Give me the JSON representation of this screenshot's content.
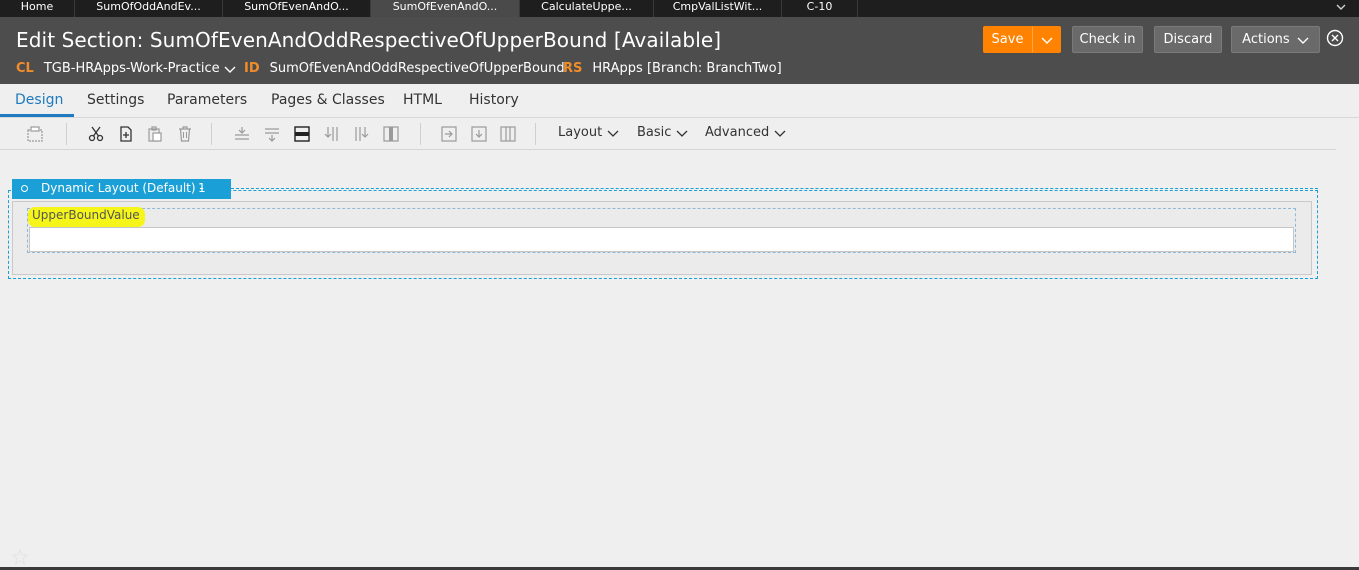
{
  "tabs": [
    {
      "label": "Home",
      "active": false
    },
    {
      "label": "SumOfOddAndEv...",
      "active": false
    },
    {
      "label": "SumOfEvenAndO...",
      "active": false
    },
    {
      "label": "SumOfEvenAndO...",
      "active": true
    },
    {
      "label": "CalculateUppe...",
      "active": false
    },
    {
      "label": "CmpValListWit...",
      "active": false
    },
    {
      "label": "C-10",
      "active": false
    }
  ],
  "header": {
    "title": "Edit Section: SumOfEvenAndOddRespectiveOfUpperBound [Available]",
    "cl_key": "CL",
    "cl_value": "TGB-HRApps-Work-Practice",
    "id_key": "ID",
    "id_value": "SumOfEvenAndOddRespectiveOfUpperBound",
    "rs_key": "RS",
    "rs_value": "HRApps [Branch: BranchTwo]"
  },
  "actions": {
    "save": "Save",
    "check_in": "Check in",
    "discard": "Discard",
    "actions": "Actions"
  },
  "subtabs": [
    "Design",
    "Settings",
    "Parameters",
    "Pages & Classes",
    "HTML",
    "History"
  ],
  "toolbar": {
    "menus": [
      "Layout",
      "Basic",
      "Advanced"
    ]
  },
  "canvas": {
    "layout_label": "Dynamic Layout (Default) -",
    "layout_number": "1",
    "field_label": "UpperBoundValue",
    "field_value": ""
  },
  "colors": {
    "accent": "#ff8300",
    "layout_blue": "#1a9fd6",
    "highlight": "#f5f51a",
    "active_tab": "#1f7abf"
  }
}
